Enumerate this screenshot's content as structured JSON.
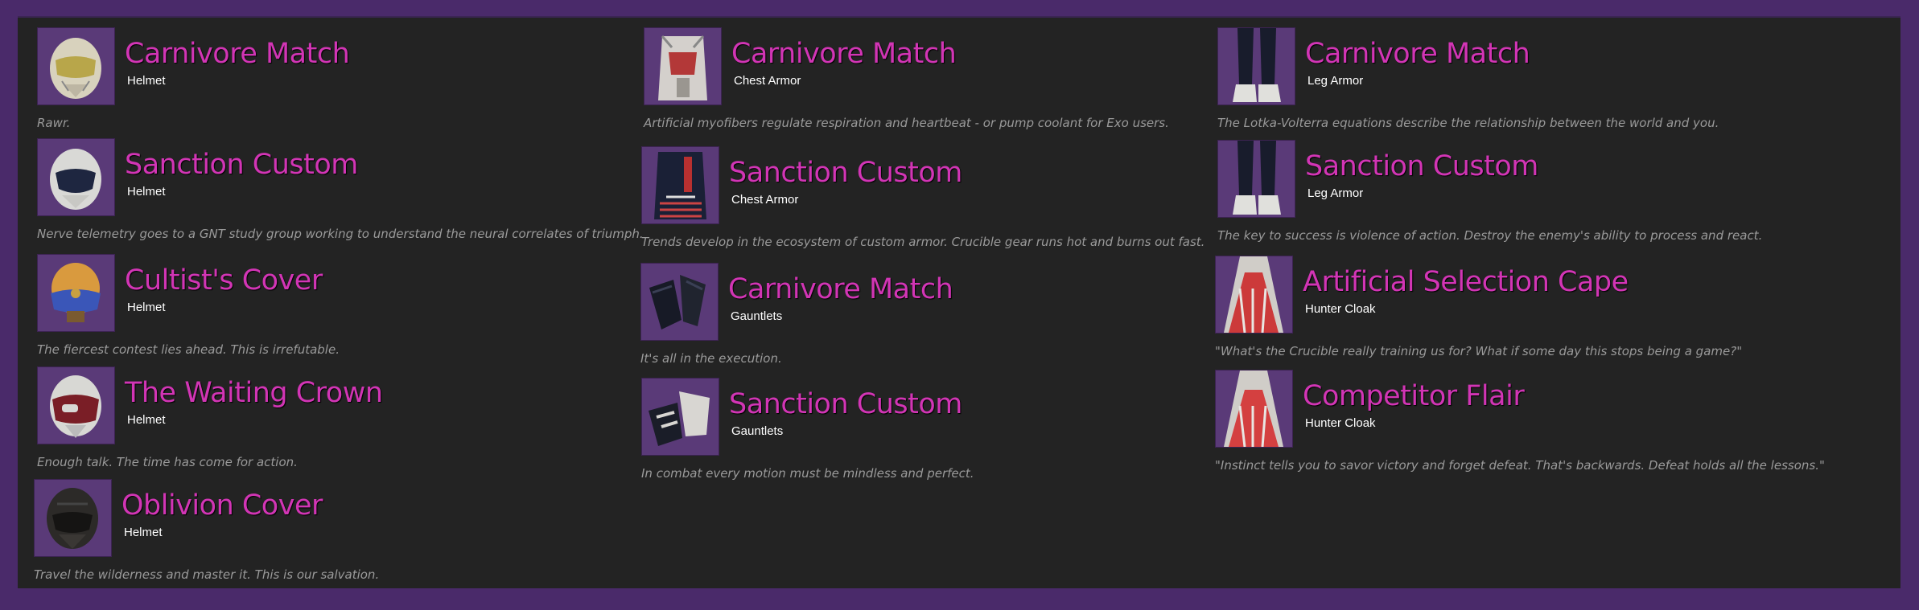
{
  "columns": [
    {
      "items": [
        {
          "name": "Carnivore Match",
          "type": "Helmet",
          "description": "Rawr.",
          "icon": "helmet-icon"
        },
        {
          "name": "Sanction Custom",
          "type": "Helmet",
          "description": "Nerve telemetry goes to a GNT study group working to understand the neural correlates of triumph.",
          "icon": "helmet-icon"
        },
        {
          "name": "Cultist's Cover",
          "type": "Helmet",
          "description": "The fiercest contest lies ahead. This is irrefutable.",
          "icon": "helmet-icon"
        },
        {
          "name": "The Waiting Crown",
          "type": "Helmet",
          "description": "Enough talk. The time has come for action.",
          "icon": "helmet-icon"
        },
        {
          "name": "Oblivion Cover",
          "type": "Helmet",
          "description": "Travel the wilderness and master it. This is our salvation.",
          "icon": "helmet-icon"
        }
      ]
    },
    {
      "items": [
        {
          "name": "Carnivore Match",
          "type": "Chest Armor",
          "description": "Artificial myofibers regulate respiration and heartbeat - or pump coolant for Exo users.",
          "icon": "chest-armor-icon"
        },
        {
          "name": "Sanction Custom",
          "type": "Chest Armor",
          "description": "Trends develop in the ecosystem of custom armor. Crucible gear runs hot and burns out fast.",
          "icon": "chest-armor-icon"
        },
        {
          "name": "Carnivore Match",
          "type": "Gauntlets",
          "description": "It's all in the execution.",
          "icon": "gauntlets-icon"
        },
        {
          "name": "Sanction Custom",
          "type": "Gauntlets",
          "description": "In combat every motion must be mindless and perfect.",
          "icon": "gauntlets-icon"
        }
      ]
    },
    {
      "items": [
        {
          "name": "Carnivore Match",
          "type": "Leg Armor",
          "description": "The Lotka-Volterra equations describe the relationship between the world and you.",
          "icon": "leg-armor-icon"
        },
        {
          "name": "Sanction Custom",
          "type": "Leg Armor",
          "description": "The key to success is violence of action. Destroy the enemy's ability to process and react.",
          "icon": "leg-armor-icon"
        },
        {
          "name": "Artificial Selection Cape",
          "type": "Hunter Cloak",
          "description": "\"What's the Crucible really training us for? What if some day this stops being a game?\"",
          "icon": "cloak-icon"
        },
        {
          "name": "Competitor Flair",
          "type": "Hunter Cloak",
          "description": "\"Instinct tells you to savor victory and forget defeat. That's backwards. Defeat holds all the lessons.\"",
          "icon": "cloak-icon"
        }
      ]
    }
  ]
}
